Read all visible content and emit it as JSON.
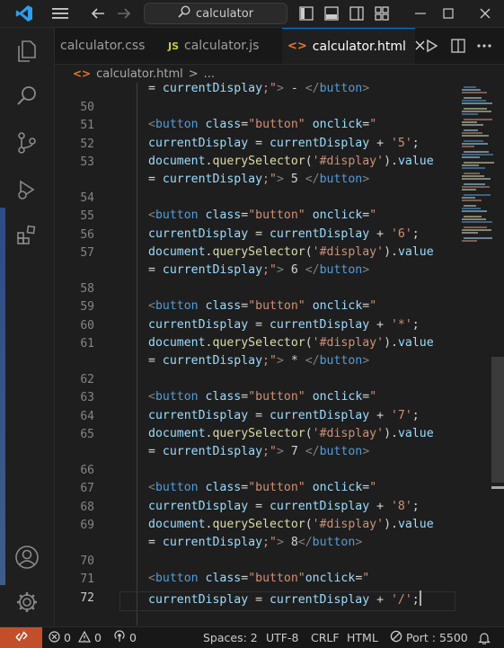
{
  "titlebar": {
    "search_text": "calculator"
  },
  "tabs": [
    {
      "label": "calculator.css"
    },
    {
      "label": "calculator.js",
      "lang_badge": "JS"
    },
    {
      "label": "calculator.html",
      "active": true
    }
  ],
  "breadcrumb": {
    "file": "calculator.html",
    "separator": ">",
    "more": "..."
  },
  "editor": {
    "top_partial": [
      {
        "t": "op",
        "v": "= "
      },
      {
        "t": "var",
        "v": "currentDisplay"
      },
      {
        "t": "str",
        "v": ";\""
      },
      {
        "t": "punc",
        "v": ">"
      },
      {
        "t": "txt",
        "v": " - "
      },
      {
        "t": "punc",
        "v": "</"
      },
      {
        "t": "tag",
        "v": "button"
      },
      {
        "t": "punc",
        "v": ">"
      }
    ],
    "lines": [
      {
        "num": "50",
        "tokens": []
      },
      {
        "num": "51",
        "tokens": [
          {
            "t": "punc",
            "v": "<"
          },
          {
            "t": "tag",
            "v": "button"
          },
          {
            "t": "txt",
            "v": " "
          },
          {
            "t": "attr",
            "v": "class"
          },
          {
            "t": "op",
            "v": "="
          },
          {
            "t": "str",
            "v": "\"button\""
          },
          {
            "t": "txt",
            "v": " "
          },
          {
            "t": "attr",
            "v": "onclick"
          },
          {
            "t": "op",
            "v": "="
          },
          {
            "t": "str",
            "v": "\""
          }
        ]
      },
      {
        "num": "52",
        "tokens": [
          {
            "t": "var",
            "v": "currentDisplay"
          },
          {
            "t": "op",
            "v": " = "
          },
          {
            "t": "var",
            "v": "currentDisplay"
          },
          {
            "t": "op",
            "v": " + "
          },
          {
            "t": "str",
            "v": "'5'"
          },
          {
            "t": "txt",
            "v": ";"
          }
        ]
      },
      {
        "num": "53",
        "tokens": [
          {
            "t": "var",
            "v": "document"
          },
          {
            "t": "txt",
            "v": "."
          },
          {
            "t": "fn",
            "v": "querySelector"
          },
          {
            "t": "txt",
            "v": "("
          },
          {
            "t": "str",
            "v": "'#display'"
          },
          {
            "t": "txt",
            "v": ")."
          },
          {
            "t": "var",
            "v": "value"
          }
        ],
        "wrap": [
          {
            "t": "op",
            "v": "= "
          },
          {
            "t": "var",
            "v": "currentDisplay"
          },
          {
            "t": "str",
            "v": ";\""
          },
          {
            "t": "punc",
            "v": ">"
          },
          {
            "t": "txt",
            "v": " 5 "
          },
          {
            "t": "punc",
            "v": "</"
          },
          {
            "t": "tag",
            "v": "button"
          },
          {
            "t": "punc",
            "v": ">"
          }
        ]
      },
      {
        "num": "54",
        "tokens": []
      },
      {
        "num": "55",
        "tokens": [
          {
            "t": "punc",
            "v": "<"
          },
          {
            "t": "tag",
            "v": "button"
          },
          {
            "t": "txt",
            "v": " "
          },
          {
            "t": "attr",
            "v": "class"
          },
          {
            "t": "op",
            "v": "="
          },
          {
            "t": "str",
            "v": "\"button\""
          },
          {
            "t": "txt",
            "v": " "
          },
          {
            "t": "attr",
            "v": "onclick"
          },
          {
            "t": "op",
            "v": "="
          },
          {
            "t": "str",
            "v": "\""
          }
        ]
      },
      {
        "num": "56",
        "tokens": [
          {
            "t": "var",
            "v": "currentDisplay"
          },
          {
            "t": "op",
            "v": " = "
          },
          {
            "t": "var",
            "v": "currentDisplay"
          },
          {
            "t": "op",
            "v": " + "
          },
          {
            "t": "str",
            "v": "'6'"
          },
          {
            "t": "txt",
            "v": ";"
          }
        ]
      },
      {
        "num": "57",
        "tokens": [
          {
            "t": "var",
            "v": "document"
          },
          {
            "t": "txt",
            "v": "."
          },
          {
            "t": "fn",
            "v": "querySelector"
          },
          {
            "t": "txt",
            "v": "("
          },
          {
            "t": "str",
            "v": "'#display'"
          },
          {
            "t": "txt",
            "v": ")."
          },
          {
            "t": "var",
            "v": "value"
          }
        ],
        "wrap": [
          {
            "t": "op",
            "v": "= "
          },
          {
            "t": "var",
            "v": "currentDisplay"
          },
          {
            "t": "str",
            "v": ";\""
          },
          {
            "t": "punc",
            "v": ">"
          },
          {
            "t": "txt",
            "v": " 6 "
          },
          {
            "t": "punc",
            "v": "</"
          },
          {
            "t": "tag",
            "v": "button"
          },
          {
            "t": "punc",
            "v": ">"
          }
        ]
      },
      {
        "num": "58",
        "tokens": []
      },
      {
        "num": "59",
        "tokens": [
          {
            "t": "punc",
            "v": "<"
          },
          {
            "t": "tag",
            "v": "button"
          },
          {
            "t": "txt",
            "v": " "
          },
          {
            "t": "attr",
            "v": "class"
          },
          {
            "t": "op",
            "v": "="
          },
          {
            "t": "str",
            "v": "\"button\""
          },
          {
            "t": "txt",
            "v": " "
          },
          {
            "t": "attr",
            "v": "onclick"
          },
          {
            "t": "op",
            "v": "="
          },
          {
            "t": "str",
            "v": "\""
          }
        ]
      },
      {
        "num": "60",
        "tokens": [
          {
            "t": "var",
            "v": "currentDisplay"
          },
          {
            "t": "op",
            "v": " = "
          },
          {
            "t": "var",
            "v": "currentDisplay"
          },
          {
            "t": "op",
            "v": " + "
          },
          {
            "t": "str",
            "v": "'*'"
          },
          {
            "t": "txt",
            "v": ";"
          }
        ]
      },
      {
        "num": "61",
        "tokens": [
          {
            "t": "var",
            "v": "document"
          },
          {
            "t": "txt",
            "v": "."
          },
          {
            "t": "fn",
            "v": "querySelector"
          },
          {
            "t": "txt",
            "v": "("
          },
          {
            "t": "str",
            "v": "'#display'"
          },
          {
            "t": "txt",
            "v": ")."
          },
          {
            "t": "var",
            "v": "value"
          }
        ],
        "wrap": [
          {
            "t": "op",
            "v": "= "
          },
          {
            "t": "var",
            "v": "currentDisplay"
          },
          {
            "t": "str",
            "v": ";\""
          },
          {
            "t": "punc",
            "v": ">"
          },
          {
            "t": "txt",
            "v": " * "
          },
          {
            "t": "punc",
            "v": "</"
          },
          {
            "t": "tag",
            "v": "button"
          },
          {
            "t": "punc",
            "v": ">"
          }
        ]
      },
      {
        "num": "62",
        "tokens": []
      },
      {
        "num": "63",
        "tokens": [
          {
            "t": "punc",
            "v": "<"
          },
          {
            "t": "tag",
            "v": "button"
          },
          {
            "t": "txt",
            "v": " "
          },
          {
            "t": "attr",
            "v": "class"
          },
          {
            "t": "op",
            "v": "="
          },
          {
            "t": "str",
            "v": "\"button\""
          },
          {
            "t": "txt",
            "v": " "
          },
          {
            "t": "attr",
            "v": "onclick"
          },
          {
            "t": "op",
            "v": "="
          },
          {
            "t": "str",
            "v": "\""
          }
        ]
      },
      {
        "num": "64",
        "tokens": [
          {
            "t": "var",
            "v": "currentDisplay"
          },
          {
            "t": "op",
            "v": " = "
          },
          {
            "t": "var",
            "v": "currentDisplay"
          },
          {
            "t": "op",
            "v": " + "
          },
          {
            "t": "str",
            "v": "'7'"
          },
          {
            "t": "txt",
            "v": ";"
          }
        ]
      },
      {
        "num": "65",
        "tokens": [
          {
            "t": "var",
            "v": "document"
          },
          {
            "t": "txt",
            "v": "."
          },
          {
            "t": "fn",
            "v": "querySelector"
          },
          {
            "t": "txt",
            "v": "("
          },
          {
            "t": "str",
            "v": "'#display'"
          },
          {
            "t": "txt",
            "v": ")."
          },
          {
            "t": "var",
            "v": "value"
          }
        ],
        "wrap": [
          {
            "t": "op",
            "v": "= "
          },
          {
            "t": "var",
            "v": "currentDisplay"
          },
          {
            "t": "str",
            "v": ";\""
          },
          {
            "t": "punc",
            "v": ">"
          },
          {
            "t": "txt",
            "v": " 7 "
          },
          {
            "t": "punc",
            "v": "</"
          },
          {
            "t": "tag",
            "v": "button"
          },
          {
            "t": "punc",
            "v": ">"
          }
        ]
      },
      {
        "num": "66",
        "tokens": []
      },
      {
        "num": "67",
        "tokens": [
          {
            "t": "punc",
            "v": "<"
          },
          {
            "t": "tag",
            "v": "button"
          },
          {
            "t": "txt",
            "v": " "
          },
          {
            "t": "attr",
            "v": "class"
          },
          {
            "t": "op",
            "v": "="
          },
          {
            "t": "str",
            "v": "\"button\""
          },
          {
            "t": "txt",
            "v": " "
          },
          {
            "t": "attr",
            "v": "onclick"
          },
          {
            "t": "op",
            "v": "="
          },
          {
            "t": "str",
            "v": "\""
          }
        ]
      },
      {
        "num": "68",
        "tokens": [
          {
            "t": "var",
            "v": "currentDisplay"
          },
          {
            "t": "op",
            "v": " = "
          },
          {
            "t": "var",
            "v": "currentDisplay"
          },
          {
            "t": "op",
            "v": " + "
          },
          {
            "t": "str",
            "v": "'8'"
          },
          {
            "t": "txt",
            "v": ";"
          }
        ]
      },
      {
        "num": "69",
        "tokens": [
          {
            "t": "var",
            "v": "document"
          },
          {
            "t": "txt",
            "v": "."
          },
          {
            "t": "fn",
            "v": "querySelector"
          },
          {
            "t": "txt",
            "v": "("
          },
          {
            "t": "str",
            "v": "'#display'"
          },
          {
            "t": "txt",
            "v": ")."
          },
          {
            "t": "var",
            "v": "value"
          }
        ],
        "wrap": [
          {
            "t": "op",
            "v": "= "
          },
          {
            "t": "var",
            "v": "currentDisplay"
          },
          {
            "t": "str",
            "v": ";\""
          },
          {
            "t": "punc",
            "v": ">"
          },
          {
            "t": "txt",
            "v": " 8"
          },
          {
            "t": "punc",
            "v": "</"
          },
          {
            "t": "tag",
            "v": "button"
          },
          {
            "t": "punc",
            "v": ">"
          }
        ]
      },
      {
        "num": "70",
        "tokens": []
      },
      {
        "num": "71",
        "tokens": [
          {
            "t": "punc",
            "v": "<"
          },
          {
            "t": "tag",
            "v": "button"
          },
          {
            "t": "txt",
            "v": " "
          },
          {
            "t": "attr",
            "v": "class"
          },
          {
            "t": "op",
            "v": "="
          },
          {
            "t": "str",
            "v": "\"button\""
          },
          {
            "t": "attr",
            "v": "onclick"
          },
          {
            "t": "op",
            "v": "="
          },
          {
            "t": "str",
            "v": "\""
          }
        ]
      },
      {
        "num": "72",
        "current": true,
        "tokens": [
          {
            "t": "var",
            "v": "currentDisplay"
          },
          {
            "t": "op",
            "v": " = "
          },
          {
            "t": "var",
            "v": "currentDisplay"
          },
          {
            "t": "op",
            "v": " + "
          },
          {
            "t": "str",
            "v": "'/'"
          },
          {
            "t": "txt",
            "v": ";"
          }
        ]
      }
    ]
  },
  "statusbar": {
    "errors": "0",
    "warnings": "0",
    "ports": "0",
    "spaces": "Spaces: 2",
    "encoding": "UTF-8",
    "eol": "CRLF",
    "language": "HTML",
    "port": "Port : 5500"
  },
  "colors": {
    "accent": "#0078d4",
    "remote": "#c24e2a",
    "tag": "#569cd6",
    "attr": "#9cdcfe",
    "string": "#ce9178",
    "function": "#dcdcaa"
  },
  "icons": [
    "vscode-logo-icon",
    "menu-icon",
    "back-arrow-icon",
    "forward-arrow-icon",
    "search-icon",
    "toggle-sidebar-icon",
    "toggle-panel-icon",
    "toggle-secondary-sidebar-icon",
    "customize-layout-icon",
    "minimize-icon",
    "maximize-icon",
    "close-icon",
    "explorer-icon",
    "search-icon",
    "source-control-icon",
    "run-debug-icon",
    "extensions-icon",
    "account-icon",
    "settings-gear-icon",
    "run-icon",
    "split-editor-icon",
    "more-actions-icon",
    "error-icon",
    "warning-icon",
    "broadcast-icon",
    "no-sync-icon",
    "bell-icon"
  ]
}
